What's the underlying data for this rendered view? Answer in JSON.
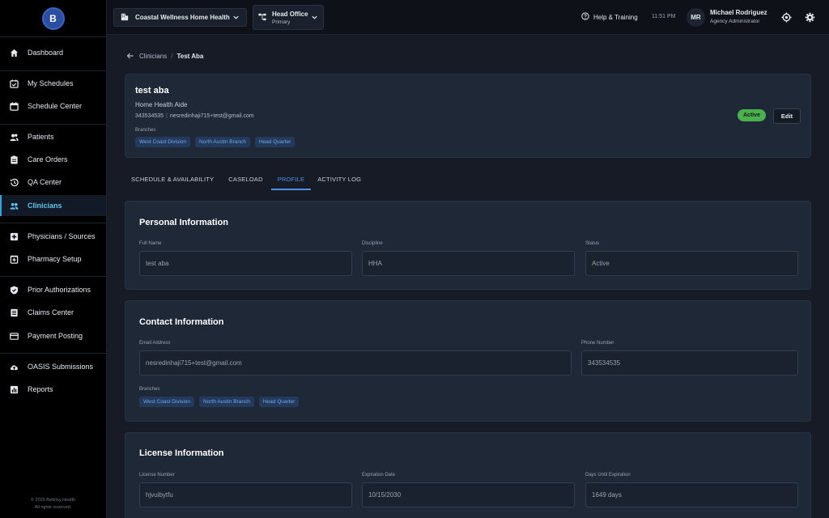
{
  "sidebar": {
    "logo_text": "B",
    "items": [
      {
        "label": "Dashboard",
        "icon": "home-icon"
      },
      {
        "label": "My Schedules",
        "icon": "calendar-check-icon"
      },
      {
        "label": "Schedule Center",
        "icon": "calendar-icon"
      },
      {
        "label": "Patients",
        "icon": "users-icon"
      },
      {
        "label": "Care Orders",
        "icon": "clipboard-icon"
      },
      {
        "label": "QA Center",
        "icon": "history-icon"
      },
      {
        "label": "Clinicians",
        "icon": "people-icon",
        "active": true
      },
      {
        "label": "Physicians / Sources",
        "icon": "medical-plus-icon"
      },
      {
        "label": "Pharmacy Setup",
        "icon": "pharmacy-icon"
      },
      {
        "label": "Prior Authorizations",
        "icon": "shield-check-icon"
      },
      {
        "label": "Claims Center",
        "icon": "document-list-icon"
      },
      {
        "label": "Payment Posting",
        "icon": "credit-card-icon"
      },
      {
        "label": "OASIS Submissions",
        "icon": "cloud-upload-icon"
      },
      {
        "label": "Reports",
        "icon": "bar-chart-icon"
      }
    ],
    "footer_line1": "© 2026 Bettrixy Health",
    "footer_line2": "All rights reserved."
  },
  "topbar": {
    "agency": "Coastal Wellness Home Health",
    "office_title": "Head Office",
    "office_sub": "Primary",
    "help": "Help & Training",
    "time": "11:51 PM",
    "avatar_initials": "MR",
    "user_name": "Michael Rodriguez",
    "user_role": "Agency Administrator"
  },
  "breadcrumb": {
    "parent": "Clinicians",
    "separator": "/",
    "current": "Test Aba"
  },
  "header_card": {
    "name": "test aba",
    "role": "Home Health Aide",
    "phone": "343534535",
    "email": "nesredinhaji715+test@gmail.com",
    "branches_label": "Branches",
    "branches": [
      "West Coast Division",
      "North Austin Branch",
      "Head Quarter"
    ],
    "status": "Active",
    "edit_label": "Edit"
  },
  "tabs": [
    {
      "label": "SCHEDULE & AVAILABILITY"
    },
    {
      "label": "CASELOAD"
    },
    {
      "label": "PROFILE",
      "active": true
    },
    {
      "label": "ACTIVITY LOG"
    }
  ],
  "personal": {
    "title": "Personal Information",
    "full_name_label": "Full Name",
    "full_name": "test aba",
    "discipline_label": "Discipline",
    "discipline": "HHA",
    "status_label": "Status",
    "status": "Active"
  },
  "contact": {
    "title": "Contact Information",
    "email_label": "Email Address",
    "email": "nesredinhaji715+test@gmail.com",
    "phone_label": "Phone Number",
    "phone": "343534535",
    "branches_label": "Branches",
    "branches": [
      "West Coast Division",
      "North Austin Branch",
      "Head Quarter"
    ]
  },
  "license": {
    "title": "License Information",
    "number_label": "License Number",
    "number": "hjvuibytfu",
    "expiration_label": "Expiration Date",
    "expiration": "10/15/2030",
    "days_label": "Days Until Expiration",
    "days": "1649 days"
  },
  "colors": {
    "accent": "#4f8fe8",
    "active_nav": "#5ec4f0",
    "status_green": "#4caf50",
    "chip_bg": "#243a5c",
    "chip_text": "#6fa8e8"
  }
}
